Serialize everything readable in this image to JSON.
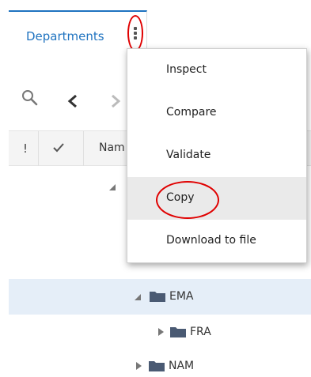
{
  "tab": {
    "label": "Departments",
    "menu_icon": "kebab-menu-icon"
  },
  "toolbar": {
    "search_icon": "search-icon",
    "prev_icon": "chevron-left-icon",
    "next_icon": "chevron-right-icon"
  },
  "table": {
    "headers": {
      "status": "!",
      "check": "checkmark-icon",
      "name": "Nam"
    },
    "rows": [
      {
        "label": "EMA",
        "expanded": true,
        "selected": true
      },
      {
        "label": "FRA",
        "expanded": false,
        "selected": false
      },
      {
        "label": "NAM",
        "expanded": false,
        "selected": false
      }
    ]
  },
  "context_menu": {
    "items": [
      {
        "label": "Inspect"
      },
      {
        "label": "Compare"
      },
      {
        "label": "Validate"
      },
      {
        "label": "Copy",
        "highlighted": true
      },
      {
        "label": "Download to file"
      }
    ]
  },
  "colors": {
    "accent": "#1f73c0",
    "annotation": "#e00000",
    "selected_row": "#e5eef8",
    "folder": "#4a5a73"
  }
}
